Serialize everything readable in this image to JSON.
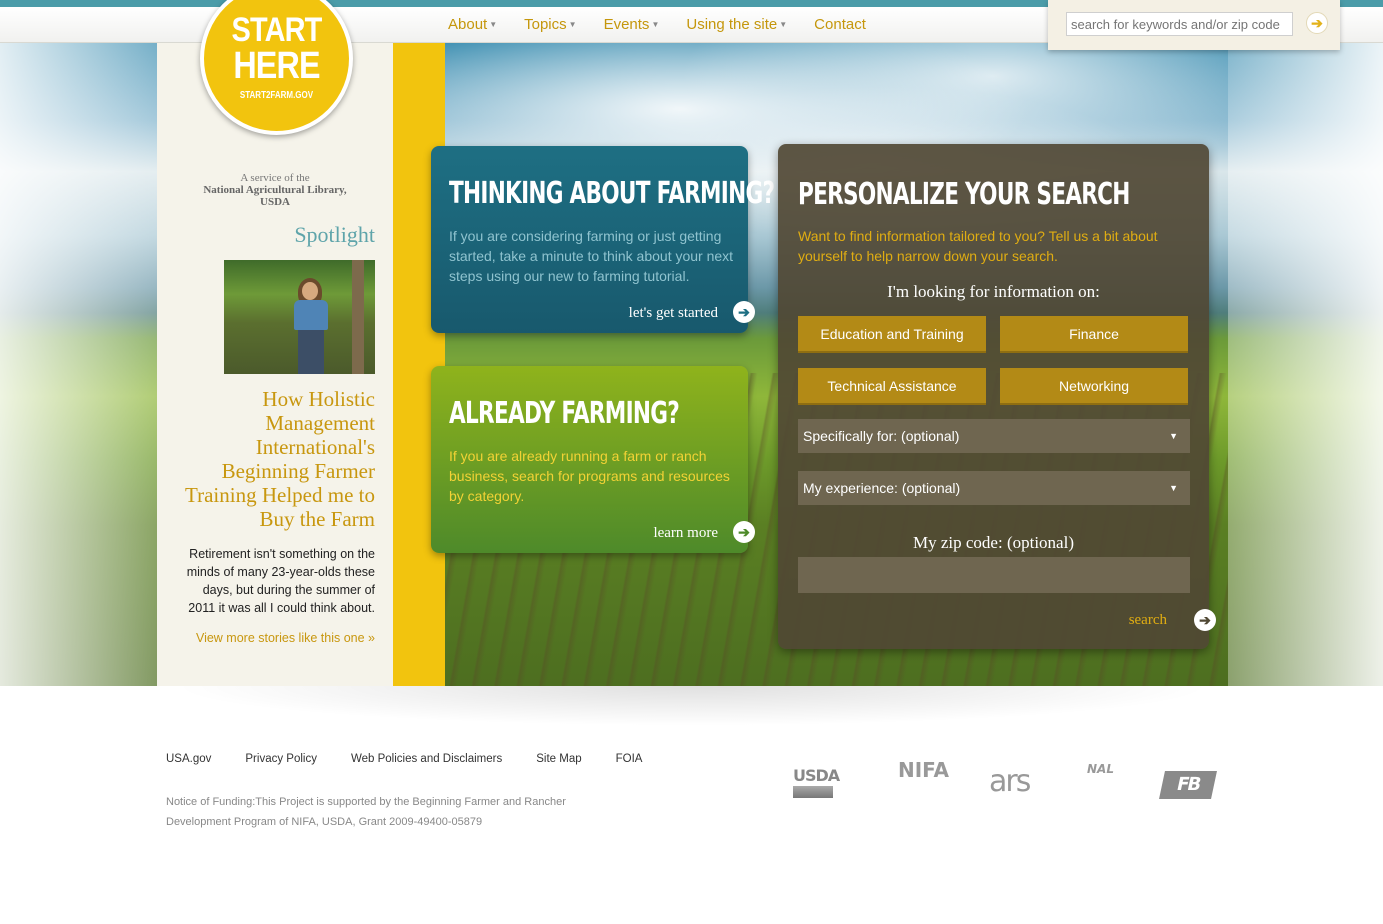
{
  "nav": {
    "items": [
      {
        "label": "About",
        "dropdown": true
      },
      {
        "label": "Topics",
        "dropdown": true
      },
      {
        "label": "Events",
        "dropdown": true
      },
      {
        "label": "Using the site",
        "dropdown": true
      },
      {
        "label": "Contact",
        "dropdown": false
      }
    ]
  },
  "search": {
    "placeholder": "search for keywords and/or zip code",
    "go_icon": "arrow-right-icon"
  },
  "logo": {
    "line1": "START",
    "line2": "HERE",
    "line3": "START2FARM.GOV"
  },
  "sidebar": {
    "service_line1": "A service of the",
    "service_line2": "National Agricultural Library,",
    "service_line3": "USDA",
    "spotlight_title": "Spotlight",
    "headline": "How Holistic Management International's Beginning Farmer Training Helped me to Buy the Farm",
    "text": "Retirement isn't something on the minds of many 23-year-olds these days, but during the summer of 2011 it was all I could think about.",
    "more_link": "View more stories like this one »"
  },
  "card_thinking": {
    "title": "THINKING ABOUT FARMING?",
    "desc": "If you are considering farming or just getting started, take a minute to think about your next steps using our new to farming tutorial.",
    "link": "let's get started"
  },
  "card_already": {
    "title": "ALREADY FARMING?",
    "desc": "If you are already running a farm or ranch business, search for programs and resources by category.",
    "link": "learn more"
  },
  "personalize": {
    "title": "PERSONALIZE YOUR SEARCH",
    "desc": "Want to find information tailored to you? Tell us a bit about yourself to help narrow down your search.",
    "looking_label": "I'm looking for information on:",
    "buttons": [
      "Education and Training",
      "Finance",
      "Technical Assistance",
      "Networking"
    ],
    "specifically": "Specifically for: (optional)",
    "experience": "My experience: (optional)",
    "zip_label": "My zip code: (optional)",
    "search_label": "search"
  },
  "footer": {
    "links": [
      "USA.gov",
      "Privacy Policy",
      "Web Policies and Disclaimers",
      "Site Map",
      "FOIA"
    ],
    "notice": "Notice of Funding:This Project is supported by the Beginning Farmer and Rancher Development Program of NIFA, USDA, Grant 2009-49400-05879",
    "logos": {
      "usda": "USDA",
      "nifa": "NIFA",
      "ars": "ars",
      "nal": "NAL",
      "fb": "FB"
    }
  },
  "colors": {
    "accent_gold": "#c8970f",
    "teal": "#4b9ca9",
    "yellow": "#f2c40e"
  }
}
